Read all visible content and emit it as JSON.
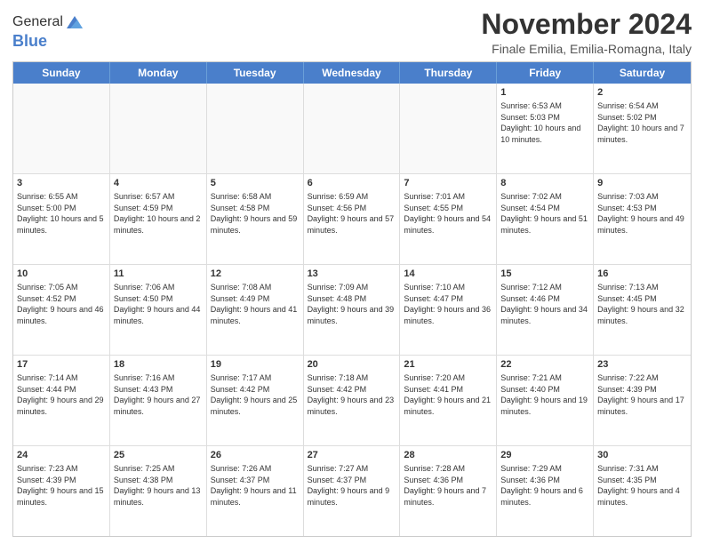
{
  "logo": {
    "general": "General",
    "blue": "Blue"
  },
  "header": {
    "month": "November 2024",
    "location": "Finale Emilia, Emilia-Romagna, Italy"
  },
  "weekdays": [
    "Sunday",
    "Monday",
    "Tuesday",
    "Wednesday",
    "Thursday",
    "Friday",
    "Saturday"
  ],
  "rows": [
    [
      {
        "day": "",
        "info": ""
      },
      {
        "day": "",
        "info": ""
      },
      {
        "day": "",
        "info": ""
      },
      {
        "day": "",
        "info": ""
      },
      {
        "day": "",
        "info": ""
      },
      {
        "day": "1",
        "info": "Sunrise: 6:53 AM\nSunset: 5:03 PM\nDaylight: 10 hours and 10 minutes."
      },
      {
        "day": "2",
        "info": "Sunrise: 6:54 AM\nSunset: 5:02 PM\nDaylight: 10 hours and 7 minutes."
      }
    ],
    [
      {
        "day": "3",
        "info": "Sunrise: 6:55 AM\nSunset: 5:00 PM\nDaylight: 10 hours and 5 minutes."
      },
      {
        "day": "4",
        "info": "Sunrise: 6:57 AM\nSunset: 4:59 PM\nDaylight: 10 hours and 2 minutes."
      },
      {
        "day": "5",
        "info": "Sunrise: 6:58 AM\nSunset: 4:58 PM\nDaylight: 9 hours and 59 minutes."
      },
      {
        "day": "6",
        "info": "Sunrise: 6:59 AM\nSunset: 4:56 PM\nDaylight: 9 hours and 57 minutes."
      },
      {
        "day": "7",
        "info": "Sunrise: 7:01 AM\nSunset: 4:55 PM\nDaylight: 9 hours and 54 minutes."
      },
      {
        "day": "8",
        "info": "Sunrise: 7:02 AM\nSunset: 4:54 PM\nDaylight: 9 hours and 51 minutes."
      },
      {
        "day": "9",
        "info": "Sunrise: 7:03 AM\nSunset: 4:53 PM\nDaylight: 9 hours and 49 minutes."
      }
    ],
    [
      {
        "day": "10",
        "info": "Sunrise: 7:05 AM\nSunset: 4:52 PM\nDaylight: 9 hours and 46 minutes."
      },
      {
        "day": "11",
        "info": "Sunrise: 7:06 AM\nSunset: 4:50 PM\nDaylight: 9 hours and 44 minutes."
      },
      {
        "day": "12",
        "info": "Sunrise: 7:08 AM\nSunset: 4:49 PM\nDaylight: 9 hours and 41 minutes."
      },
      {
        "day": "13",
        "info": "Sunrise: 7:09 AM\nSunset: 4:48 PM\nDaylight: 9 hours and 39 minutes."
      },
      {
        "day": "14",
        "info": "Sunrise: 7:10 AM\nSunset: 4:47 PM\nDaylight: 9 hours and 36 minutes."
      },
      {
        "day": "15",
        "info": "Sunrise: 7:12 AM\nSunset: 4:46 PM\nDaylight: 9 hours and 34 minutes."
      },
      {
        "day": "16",
        "info": "Sunrise: 7:13 AM\nSunset: 4:45 PM\nDaylight: 9 hours and 32 minutes."
      }
    ],
    [
      {
        "day": "17",
        "info": "Sunrise: 7:14 AM\nSunset: 4:44 PM\nDaylight: 9 hours and 29 minutes."
      },
      {
        "day": "18",
        "info": "Sunrise: 7:16 AM\nSunset: 4:43 PM\nDaylight: 9 hours and 27 minutes."
      },
      {
        "day": "19",
        "info": "Sunrise: 7:17 AM\nSunset: 4:42 PM\nDaylight: 9 hours and 25 minutes."
      },
      {
        "day": "20",
        "info": "Sunrise: 7:18 AM\nSunset: 4:42 PM\nDaylight: 9 hours and 23 minutes."
      },
      {
        "day": "21",
        "info": "Sunrise: 7:20 AM\nSunset: 4:41 PM\nDaylight: 9 hours and 21 minutes."
      },
      {
        "day": "22",
        "info": "Sunrise: 7:21 AM\nSunset: 4:40 PM\nDaylight: 9 hours and 19 minutes."
      },
      {
        "day": "23",
        "info": "Sunrise: 7:22 AM\nSunset: 4:39 PM\nDaylight: 9 hours and 17 minutes."
      }
    ],
    [
      {
        "day": "24",
        "info": "Sunrise: 7:23 AM\nSunset: 4:39 PM\nDaylight: 9 hours and 15 minutes."
      },
      {
        "day": "25",
        "info": "Sunrise: 7:25 AM\nSunset: 4:38 PM\nDaylight: 9 hours and 13 minutes."
      },
      {
        "day": "26",
        "info": "Sunrise: 7:26 AM\nSunset: 4:37 PM\nDaylight: 9 hours and 11 minutes."
      },
      {
        "day": "27",
        "info": "Sunrise: 7:27 AM\nSunset: 4:37 PM\nDaylight: 9 hours and 9 minutes."
      },
      {
        "day": "28",
        "info": "Sunrise: 7:28 AM\nSunset: 4:36 PM\nDaylight: 9 hours and 7 minutes."
      },
      {
        "day": "29",
        "info": "Sunrise: 7:29 AM\nSunset: 4:36 PM\nDaylight: 9 hours and 6 minutes."
      },
      {
        "day": "30",
        "info": "Sunrise: 7:31 AM\nSunset: 4:35 PM\nDaylight: 9 hours and 4 minutes."
      }
    ]
  ]
}
